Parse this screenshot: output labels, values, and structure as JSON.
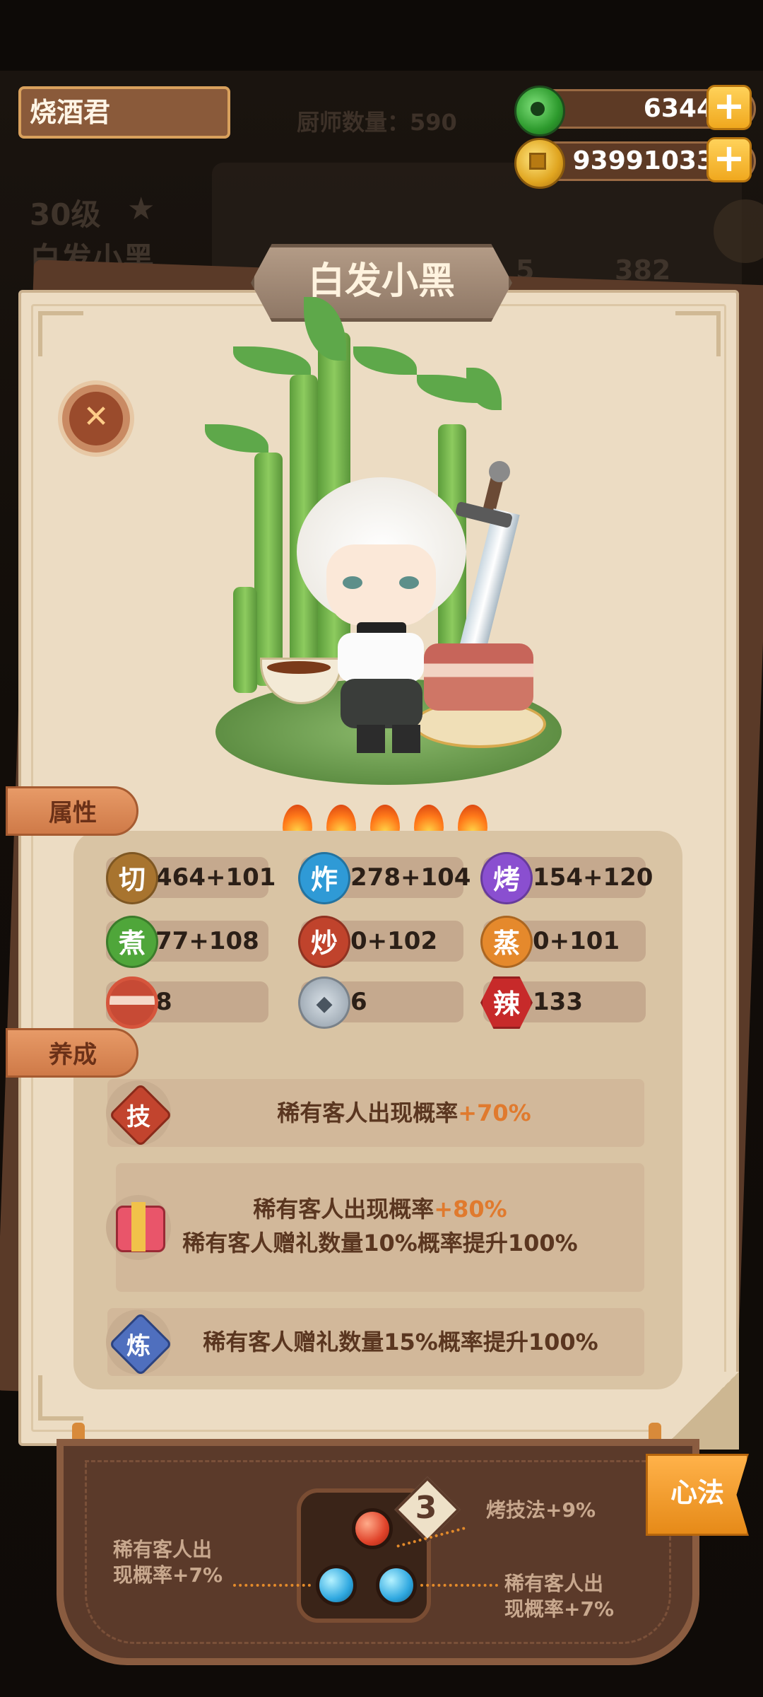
{
  "player": {
    "name": "烧酒君"
  },
  "chef_count_label": "厨师数量：590",
  "resources": {
    "jade": "6344",
    "coins": "93991033"
  },
  "background": {
    "level": "30级",
    "name": "白发小黑",
    "num1": "5",
    "num2": "382"
  },
  "chef": {
    "name": "白发小黑",
    "stars": 5
  },
  "tabs": {
    "attributes": "属性",
    "training": "养成"
  },
  "stats": [
    {
      "icon_char": "切",
      "value": "464+101",
      "color": "#a8742f"
    },
    {
      "icon_char": "炸",
      "value": "278+104",
      "color": "#2f9ad6"
    },
    {
      "icon_char": "烤",
      "value": "154+120",
      "color": "#8a4fd0"
    },
    {
      "icon_char": "煮",
      "value": "77+108",
      "color": "#4fa63a"
    },
    {
      "icon_char": "炒",
      "value": "0+102",
      "color": "#c0432c"
    },
    {
      "icon_char": "蒸",
      "value": "0+101",
      "color": "#e5892c"
    },
    {
      "icon_char": "meat-icon",
      "value": "8",
      "color": "#d5553c"
    },
    {
      "icon_char": "fish-icon",
      "value": "6",
      "color": "#8e9aa6"
    },
    {
      "icon_char": "辣",
      "value": "133",
      "color": "#c72a2a"
    }
  ],
  "skills": {
    "skill": {
      "badge": "技",
      "text": "稀有客人出现概率",
      "highlight": "+70%"
    },
    "special": {
      "line1": "稀有客人出现概率",
      "highlight": "+80%",
      "line2": "稀有客人赠礼数量10%概率提升100%"
    },
    "refine": {
      "badge": "炼",
      "text": "稀有客人赠礼数量15%概率提升100%"
    }
  },
  "heart_method": {
    "tab_label": "心法",
    "level": "3",
    "top_effect": "烤技法+9%",
    "left_effect_line1": "稀有客人出",
    "left_effect_line2": "现概率+7%",
    "right_effect_line1": "稀有客人出",
    "right_effect_line2": "现概率+7%"
  },
  "colors": {
    "accent": "#e07a2e",
    "card": "#ecdcc3",
    "panel": "#d9c4a4"
  }
}
